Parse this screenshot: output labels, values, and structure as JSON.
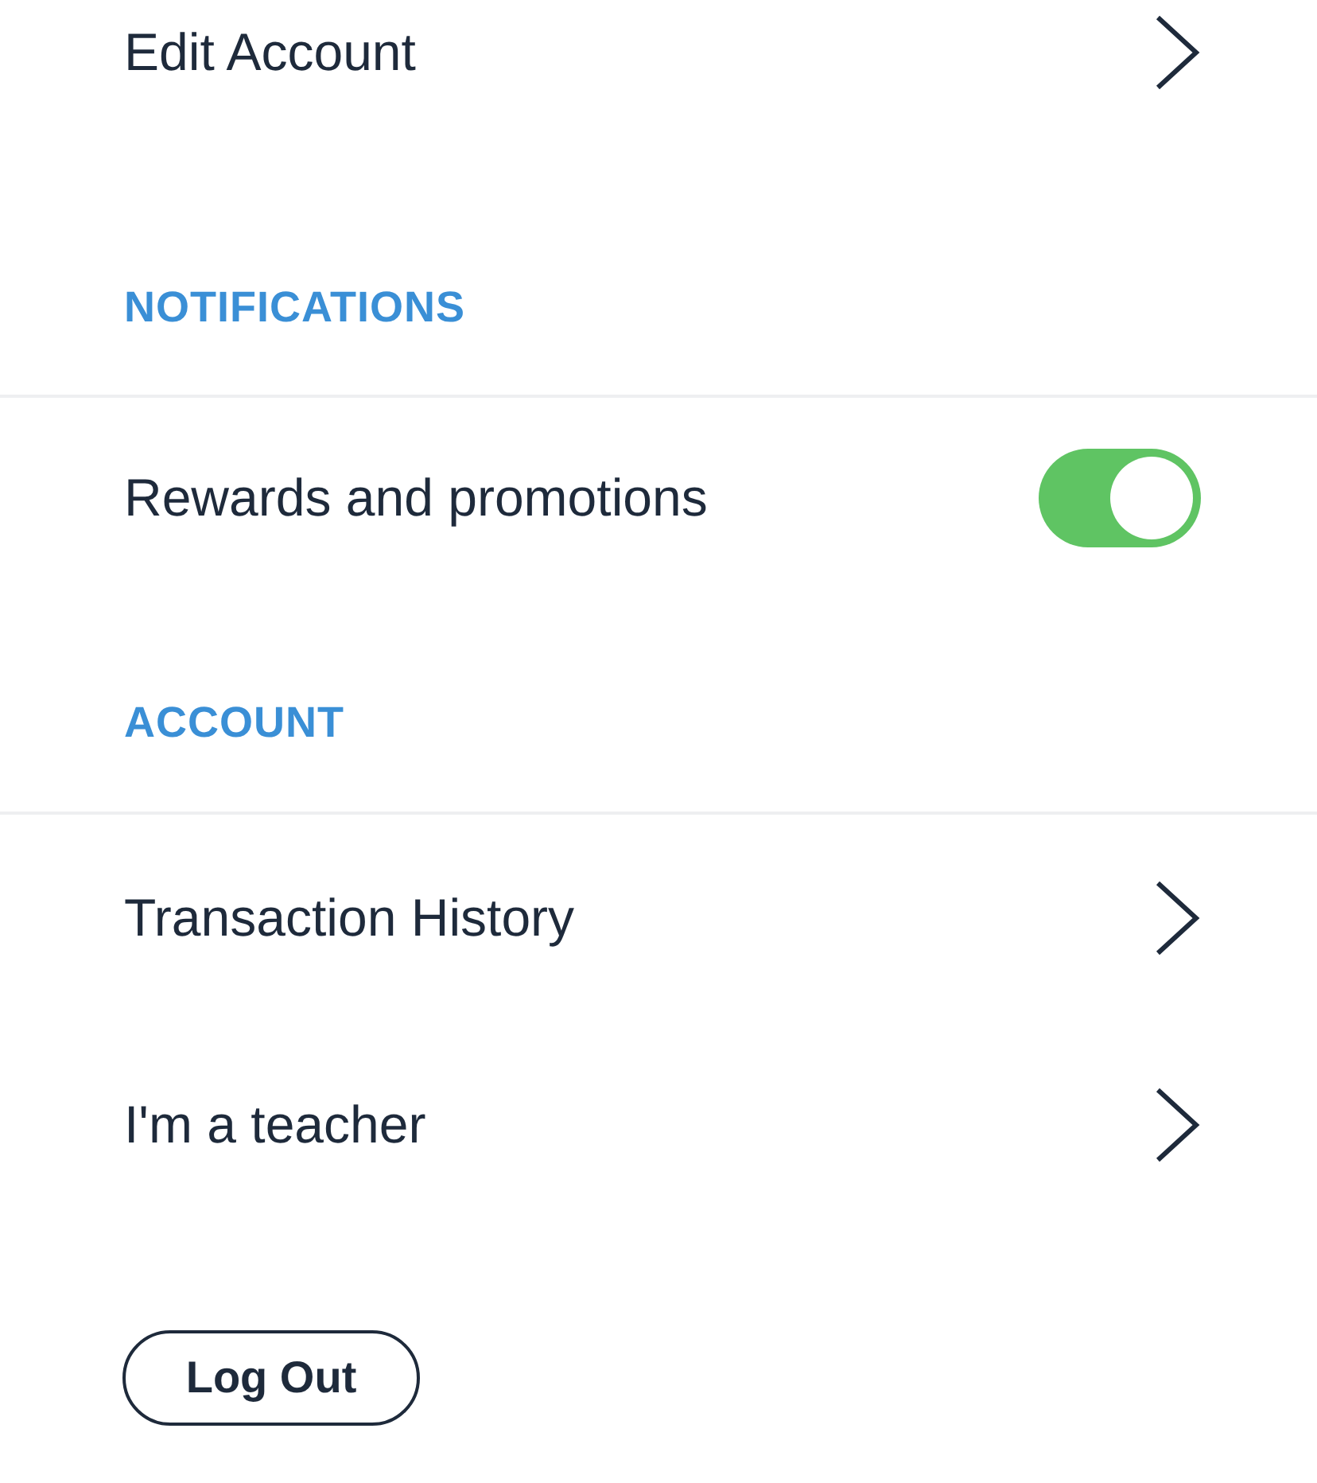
{
  "account_link": {
    "label": "Edit Account"
  },
  "sections": [
    {
      "title": "NOTIFICATIONS",
      "items": [
        {
          "kind": "toggle",
          "label": "Rewards and promotions",
          "on": true
        }
      ]
    },
    {
      "title": "ACCOUNT",
      "items": [
        {
          "kind": "link",
          "label": "Transaction History"
        },
        {
          "kind": "link",
          "label": "I'm a teacher"
        }
      ]
    }
  ],
  "logout_button": {
    "label": "Log Out"
  }
}
